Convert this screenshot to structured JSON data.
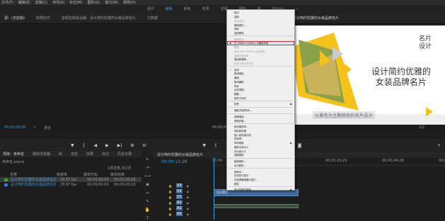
{
  "menubar": {
    "items": [
      "文件(F)",
      "编辑(E)",
      "剪辑(C)",
      "序列(S)",
      "标记(M)",
      "图形(G)",
      "窗口(W)",
      "帮助(H)"
    ]
  },
  "workspaces": {
    "items": [
      "组件",
      "编辑",
      "颜色",
      "效果",
      "音频",
      "图形",
      "库",
      "Editing",
      "»"
    ],
    "active_index": 1
  },
  "panel_tabs": {
    "source": "源：(无剪辑)",
    "effect_controls": "效果控件",
    "mixer": "音频剪辑混合器：设计简约优雅的女装品牌名片",
    "metadata": "元数据",
    "program": "节目：设计简约优雅的女装品牌名片"
  },
  "preview": {
    "title_line1": "名片",
    "title_line2": "设计",
    "headline_line1": "设计简约优雅的",
    "headline_line2": "女装品牌名片",
    "subtitle": "以黄色为主题颜色的名片设计"
  },
  "source_monitor": {
    "timecode": "00;00;00;00",
    "zoom": "适合"
  },
  "program_monitor": {
    "timecode_center": "00;00;00;00",
    "timecode_right": "1/2"
  },
  "project": {
    "tabs": [
      "项目：未命名",
      "媒体浏览器",
      "库",
      "信息",
      "效果",
      "标记",
      "历史记录"
    ],
    "path": "未命名.prproj",
    "item_count": "1项选择,共2项",
    "columns": {
      "name": "名称",
      "fps": "帧速率",
      "start": "媒体开始",
      "end": "媒体结束"
    },
    "rows": [
      {
        "name": "设计简约优雅的女装品牌名片",
        "fps": "29.97 fps",
        "start": "00;00;00;00",
        "end": "00;00;05;29",
        "color": "#3da33d",
        "selected": true
      },
      {
        "name": "设计简约优雅的女装品牌名片",
        "fps": "29.97 fps",
        "start": "00;00;00;00",
        "end": "00;00;05;29",
        "color": "#3a7ad1",
        "selected": false
      }
    ]
  },
  "timeline": {
    "title": "设计简约优雅的女装品牌名片",
    "timecode": "00;00;13;28",
    "ruler": [
      "00;00",
      "00;00;14;29",
      "00;00;29;29",
      "00;00;44;28",
      "00;00"
    ],
    "tracks": [
      "V3",
      "V2",
      "V1",
      "A1",
      "A2",
      "A3"
    ],
    "clip_label": "设计简约"
  },
  "context_menu": {
    "items": [
      {
        "label": "剪切",
        "disabled": false
      },
      {
        "label": "复制",
        "disabled": false
      },
      {
        "label": "粘贴属性...",
        "disabled": true
      },
      {
        "label": "删除属性...",
        "disabled": false
      },
      {
        "label": "清除",
        "disabled": false
      },
      {
        "label": "波纹删除",
        "disabled": false
      },
      {
        "sep": true
      },
      {
        "label": "编辑原始",
        "disabled": true
      },
      {
        "label": "在 Adobe Audition 中编辑剪辑",
        "disabled": false,
        "highlight": true
      },
      {
        "label": "替换",
        "disabled": true
      },
      {
        "label": "使用 After Effects 合成替换",
        "disabled": true
      },
      {
        "label": "使用剪辑替换",
        "disabled": true
      },
      {
        "label": "渲染和替换...",
        "disabled": false
      },
      {
        "label": "恢复未渲染的内容",
        "disabled": true
      },
      {
        "sep": true
      },
      {
        "label": "启用",
        "disabled": false,
        "checked": true
      },
      {
        "label": "取消链接",
        "disabled": false
      },
      {
        "label": "编组",
        "disabled": false
      },
      {
        "label": "取消编组",
        "disabled": false
      },
      {
        "label": "同步",
        "disabled": false
      },
      {
        "label": "合并剪辑...",
        "disabled": false
      },
      {
        "label": "嵌套...",
        "disabled": false
      },
      {
        "label": "制作子序列",
        "disabled": false
      },
      {
        "sep": true
      },
      {
        "label": "标签",
        "disabled": false,
        "submenu": true
      },
      {
        "sep": true
      },
      {
        "label": "速度/持续时间...",
        "disabled": false
      },
      {
        "sep": true
      },
      {
        "label": "音频增益...",
        "disabled": false
      },
      {
        "label": "音频声道...",
        "disabled": false
      },
      {
        "sep": true
      },
      {
        "label": "帧定格选项...",
        "disabled": false
      },
      {
        "label": "添加帧定格",
        "disabled": false
      },
      {
        "label": "插入帧定格分段",
        "disabled": false
      },
      {
        "label": "场选项...",
        "disabled": false
      },
      {
        "label": "时间插值",
        "disabled": false,
        "submenu": true
      },
      {
        "label": "缩放为帧大小",
        "disabled": false
      },
      {
        "label": "设为帧大小",
        "disabled": false
      },
      {
        "label": "调整图层",
        "disabled": false
      },
      {
        "sep": true
      },
      {
        "label": "链接媒体...",
        "disabled": false
      },
      {
        "label": "设为脱机...",
        "disabled": false
      },
      {
        "sep": true
      },
      {
        "label": "重命名...",
        "disabled": false
      },
      {
        "label": "在项目中显示",
        "disabled": false
      },
      {
        "label": "在资源管理器中显示...",
        "disabled": false
      },
      {
        "label": "属性",
        "disabled": false
      },
      {
        "sep": true
      },
      {
        "label": "显示剪辑关键帧",
        "disabled": false,
        "submenu": true
      }
    ]
  },
  "colors": {
    "accent": "#3a9bd9",
    "highlight": "#d9262a",
    "yellow": "#f4c21b"
  }
}
